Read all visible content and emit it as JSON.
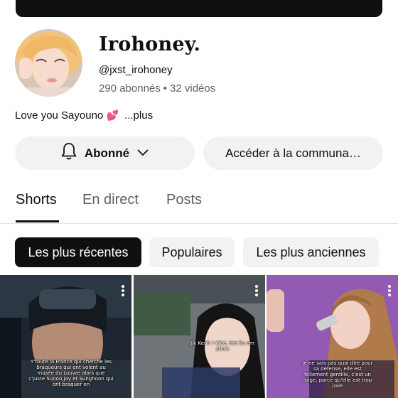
{
  "channel": {
    "name": "Irohoney.",
    "handle": "@jxst_irohoney",
    "subscribers": "290 abonnés",
    "separator": "•",
    "videos": "32 vidéos",
    "bio_text": "Love you Sayouno",
    "bio_emoji": "💕",
    "bio_more": "...plus"
  },
  "actions": {
    "subscribe_label": "Abonné",
    "community_label": "Accéder à la communa…"
  },
  "tabs": [
    {
      "label": "Shorts",
      "active": true
    },
    {
      "label": "En direct",
      "active": false
    },
    {
      "label": "Posts",
      "active": false
    }
  ],
  "filters": [
    {
      "label": "Les plus récentes",
      "selected": true
    },
    {
      "label": "Populaires",
      "selected": false
    },
    {
      "label": "Les plus anciennes",
      "selected": false
    }
  ],
  "shorts": [
    {
      "caption": "Y'toute la France qui cherche les braqueurs qui ont volent au musée du Louvre alors que c'juste Sunoo,Jay et Sunghoon qui ont braquer en"
    },
    {
      "caption": "Jik Kenh ! Wee, hm ilu em zhow"
    },
    {
      "caption": "Je ne sais pas quoi dire pour sa défense, elle est tellement gentille, c'est un ange, parce qu'elle est trop jolie"
    }
  ],
  "colors": {
    "text_primary": "#0f0f0f",
    "text_secondary": "#606060",
    "chip_bg": "#f2f2f2",
    "chip_selected_bg": "#0f0f0f",
    "heart": "#e0245e"
  },
  "icons": {
    "subscribe_bell": "bell-icon",
    "subscribe_chevron": "chevron-down-icon",
    "short_menu": "more-vert-icon"
  }
}
